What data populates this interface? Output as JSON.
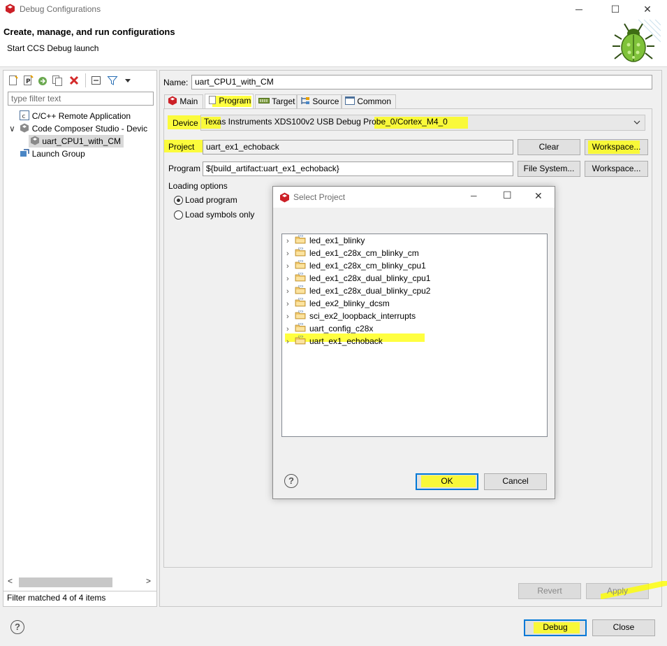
{
  "window": {
    "title": "Debug Configurations",
    "minimize": "─",
    "maximize": "☐",
    "close": "✕"
  },
  "header": {
    "title": "Create, manage, and run configurations",
    "subtitle": "Start CCS Debug launch"
  },
  "left": {
    "toolbar_icons": [
      "new-config-icon",
      "new-prototype-icon",
      "export-icon",
      "duplicate-icon",
      "delete-icon",
      "collapse-all-icon",
      "filter-icon",
      "menu-dropdown-icon"
    ],
    "filter_placeholder": "type filter text",
    "tree": [
      {
        "label": "C/C++ Remote Application",
        "expander": ""
      },
      {
        "label": "Code Composer Studio - Devic",
        "expander": "∨"
      },
      {
        "label": "uart_CPU1_with_CM",
        "expander": ""
      },
      {
        "label": "Launch Group",
        "expander": ""
      }
    ],
    "scroll_left": "<",
    "scroll_right": ">",
    "status": "Filter matched 4 of 4 items"
  },
  "config": {
    "name_label": "Name:",
    "name_value": "uart_CPU1_with_CM",
    "tabs": [
      "Main",
      "Program",
      "Target",
      "Source",
      "Common"
    ],
    "active_tab": "Program",
    "device_label": "Device",
    "device_value": "Texas Instruments XDS100v2 USB Debug Probe_0/Cortex_M4_0",
    "project_label": "Project",
    "project_value": "uart_ex1_echoback",
    "program_label": "Program",
    "program_value": "${build_artifact:uart_ex1_echoback}",
    "clear_button": "Clear",
    "workspace_button": "Workspace...",
    "filesystem_button": "File System...",
    "workspace_button2": "Workspace...",
    "loading_label": "Loading options",
    "load_program": "Load program",
    "load_symbols": "Load symbols only",
    "revert_button": "Revert",
    "apply_button": "Apply"
  },
  "dialog": {
    "title": "Select Project",
    "projects": [
      "led_ex1_blinky",
      "led_ex1_c28x_cm_blinky_cm",
      "led_ex1_c28x_cm_blinky_cpu1",
      "led_ex1_c28x_dual_blinky_cpu1",
      "led_ex1_c28x_dual_blinky_cpu2",
      "led_ex2_blinky_dcsm",
      "sci_ex2_loopback_interrupts",
      "uart_config_c28x",
      "uart_ex1_echoback"
    ],
    "ok_button": "OK",
    "cancel_button": "Cancel",
    "help": "?"
  },
  "footer": {
    "help": "?",
    "debug_button": "Debug",
    "close_button": "Close"
  },
  "colors": {
    "highlight": "#ffff00",
    "default_button_border": "#0078d7",
    "ccs_red": "#cc2027"
  }
}
